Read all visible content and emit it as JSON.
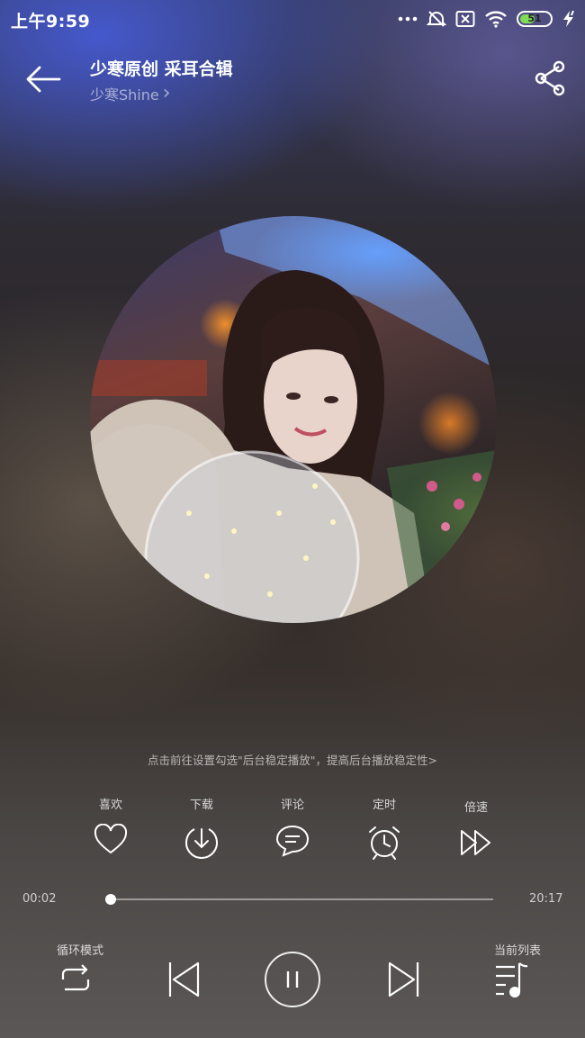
{
  "status_bar": {
    "time": "上午9:59",
    "battery_level": "51"
  },
  "header": {
    "title": "少寒原创 采耳合辑",
    "artist": "少寒Shine",
    "artist_chevron": "›"
  },
  "tip": "点击前往设置勾选\"后台稳定播放\"，提高后台播放稳定性>",
  "actions": [
    {
      "label": "喜欢",
      "icon": "heart-icon"
    },
    {
      "label": "下载",
      "icon": "download-icon"
    },
    {
      "label": "评论",
      "icon": "comment-icon"
    },
    {
      "label": "定时",
      "icon": "alarm-clock-icon"
    },
    {
      "label": "倍速",
      "icon": "speed-icon"
    }
  ],
  "progress": {
    "current": "00:02",
    "total": "20:17",
    "fraction": 0.002
  },
  "controls": {
    "loop_mode_label": "循环模式",
    "playlist_label": "当前列表",
    "state": "playing"
  }
}
